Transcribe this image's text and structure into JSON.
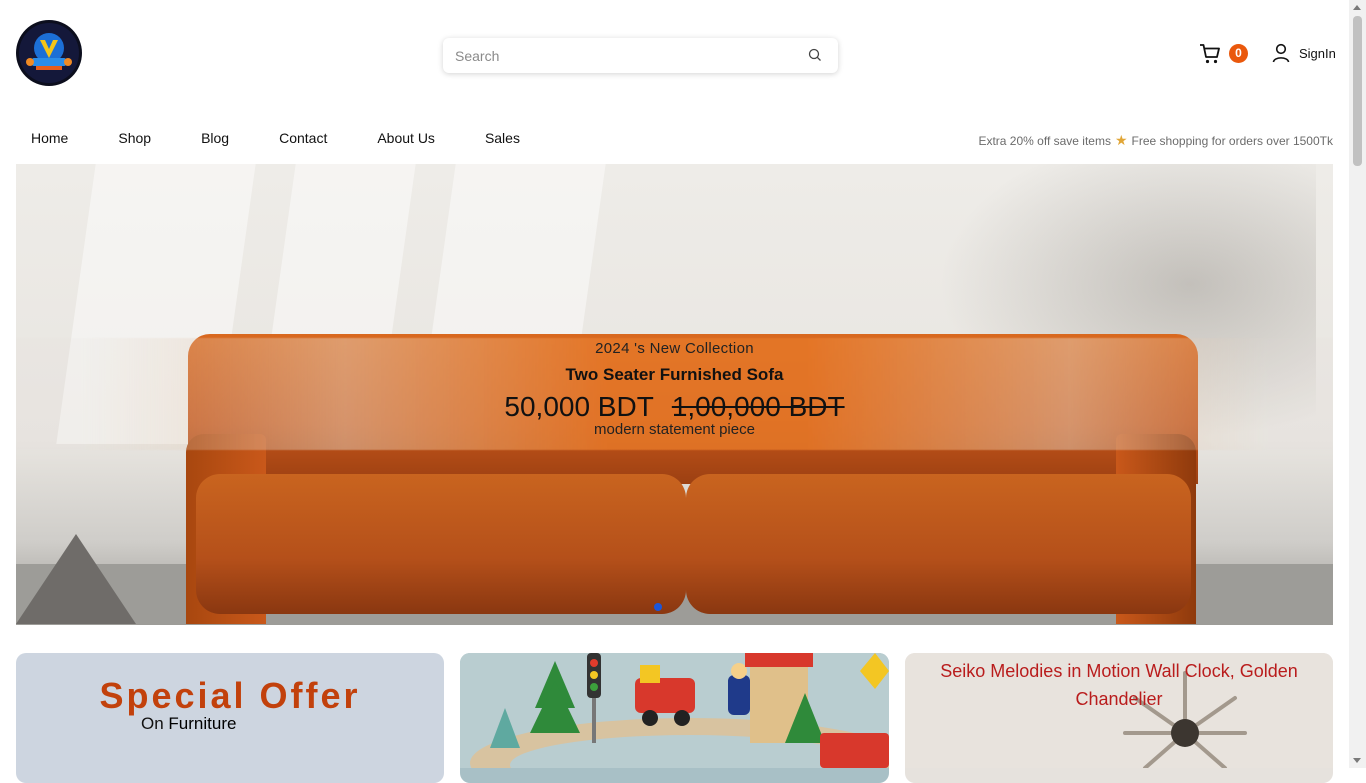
{
  "header": {
    "search": {
      "placeholder": "Search",
      "value": ""
    },
    "cart": {
      "count": "0"
    },
    "signin_label": "SignIn"
  },
  "nav": {
    "items": [
      "Home",
      "Shop",
      "Blog",
      "Contact",
      "About Us",
      "Sales"
    ]
  },
  "promo": {
    "left": "Extra 20% off save items",
    "right": "Free shopping for orders over 1500Tk"
  },
  "hero": {
    "collection": "2024 's New Collection",
    "product": "Two Seater Furnished Sofa",
    "price": "50,000 BDT",
    "old_price": "1,00,000 BDT",
    "tagline": "modern statement piece"
  },
  "cards": {
    "offer_title": "Special Offer",
    "offer_on": "On",
    "offer_category": "Furniture",
    "clock_title": "Seiko Melodies in Motion Wall Clock, Golden Chandelier"
  },
  "colors": {
    "accent": "#ea580c",
    "offer_title": "#c2410c",
    "clock_title": "#b91c1c",
    "slider_dot": "#1a56db"
  }
}
